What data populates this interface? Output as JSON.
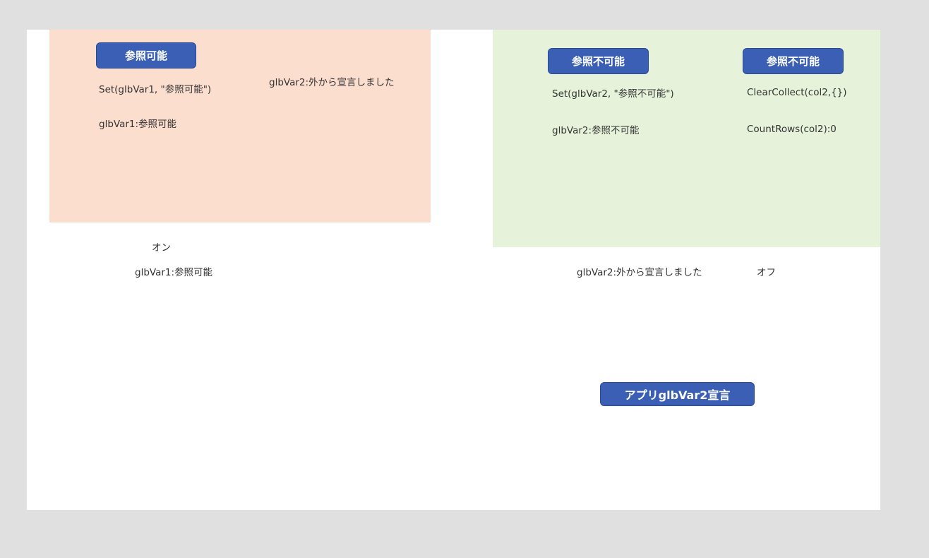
{
  "left_panel": {
    "button_label": "参照可能",
    "set_formula": "Set(glbVar1, \"参照可能\")",
    "var1_display": "glbVar1:参照可能",
    "var2_display": "glbVar2:外から宣言しました"
  },
  "right_panel": {
    "button1_label": "参照不可能",
    "button2_label": "参照不可能",
    "set_formula": "Set(glbVar2, \"参照不可能\")",
    "var2_display": "glbVar2:参照不可能",
    "clear_formula": "ClearCollect(col2,{})",
    "count_display": "CountRows(col2):0"
  },
  "outside": {
    "toggle_on_label": "オン",
    "var1_display": "glbVar1:参照可能",
    "var2_display": "glbVar2:外から宣言しました",
    "toggle_off_label": "オフ",
    "app_button_label": "アプリglbVar2宣言"
  },
  "colors": {
    "left_panel_bg": "#fcdecf",
    "right_panel_bg": "#e6f3da",
    "button_bg": "#3a5fb4"
  }
}
